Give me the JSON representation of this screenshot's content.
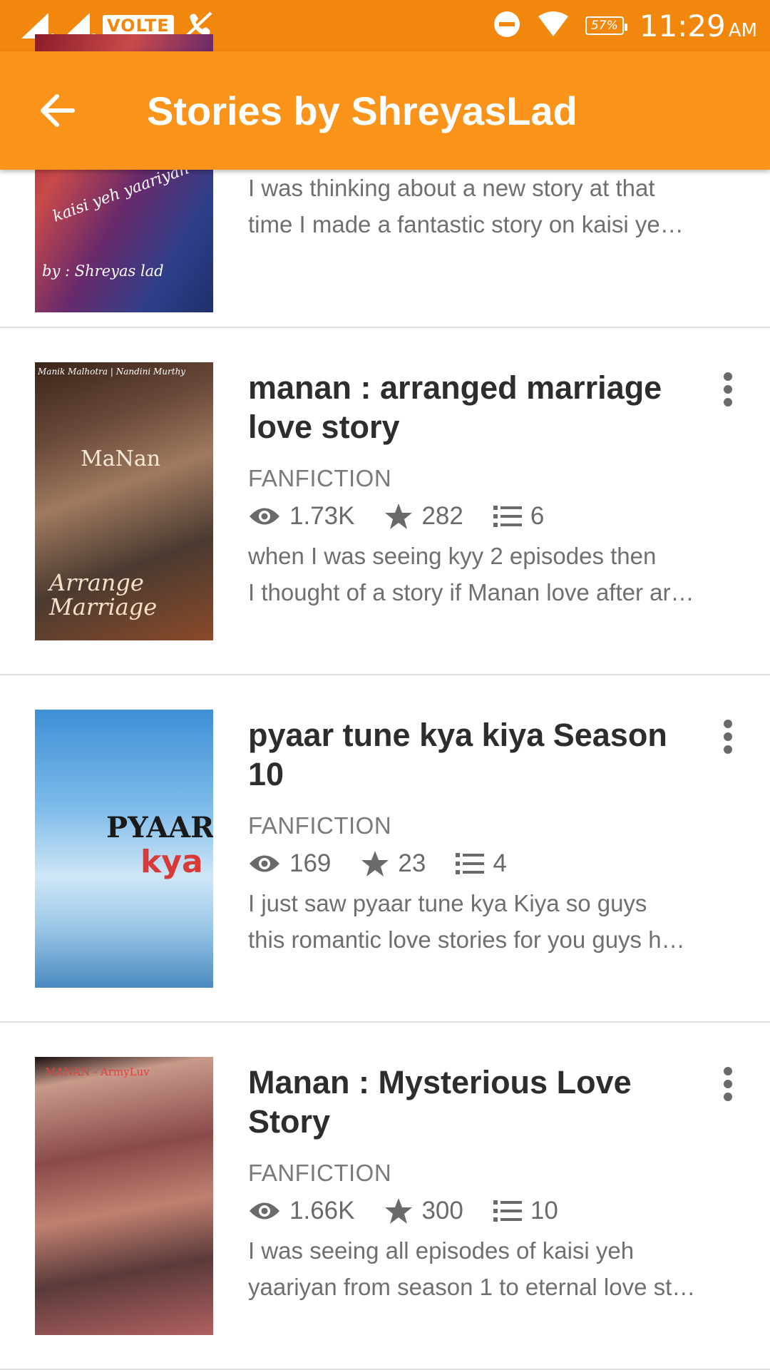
{
  "status_bar": {
    "sim1_label": "1",
    "sim2_label": "2",
    "volte_label": "VOLTE",
    "battery_label": "57%",
    "time": "11:29",
    "ampm": "AM"
  },
  "app_bar": {
    "title": "Stories by ShreyasLad",
    "back_icon": "arrow-back-icon",
    "color": "#f9931a"
  },
  "partial_story": {
    "cover_text_1": "kaisi yeh yaariyan",
    "cover_text_2": "by : Shreyas lad",
    "desc_line1": "I was thinking about a new story at that",
    "desc_line2": "time I made a fantastic story  on kaisi ye…"
  },
  "stories": [
    {
      "title": "manan : arranged marriage love story",
      "genre": "FANFICTION",
      "reads": "1.73K",
      "votes": "282",
      "parts": "6",
      "desc_line1": "when I was seeing kyy 2 episodes then",
      "desc_line2": "I thought of a story if Manan love after ar…",
      "cover_top": "Manik Malhotra | Nandini Murthy",
      "cover_mid": "MaNan",
      "cover_bottom": "Arrange Marriage"
    },
    {
      "title": "pyaar tune kya kiya  Season 10",
      "genre": "FANFICTION",
      "reads": "169",
      "votes": "23",
      "parts": "4",
      "desc_line1": "I just saw pyaar tune kya Kiya so guys",
      "desc_line2": "this romantic love stories for you guys h…",
      "cover_word1": "PYAAR",
      "cover_word2": "kya"
    },
    {
      "title": "Manan : Mysterious Love Story",
      "genre": "FANFICTION",
      "reads": "1.66K",
      "votes": "300",
      "parts": "10",
      "desc_line1": "I was seeing all episodes of kaisi yeh",
      "desc_line2": "yaariyan from season 1 to eternal love st…",
      "cover_top": "MANAN - ArmyLuv"
    }
  ]
}
